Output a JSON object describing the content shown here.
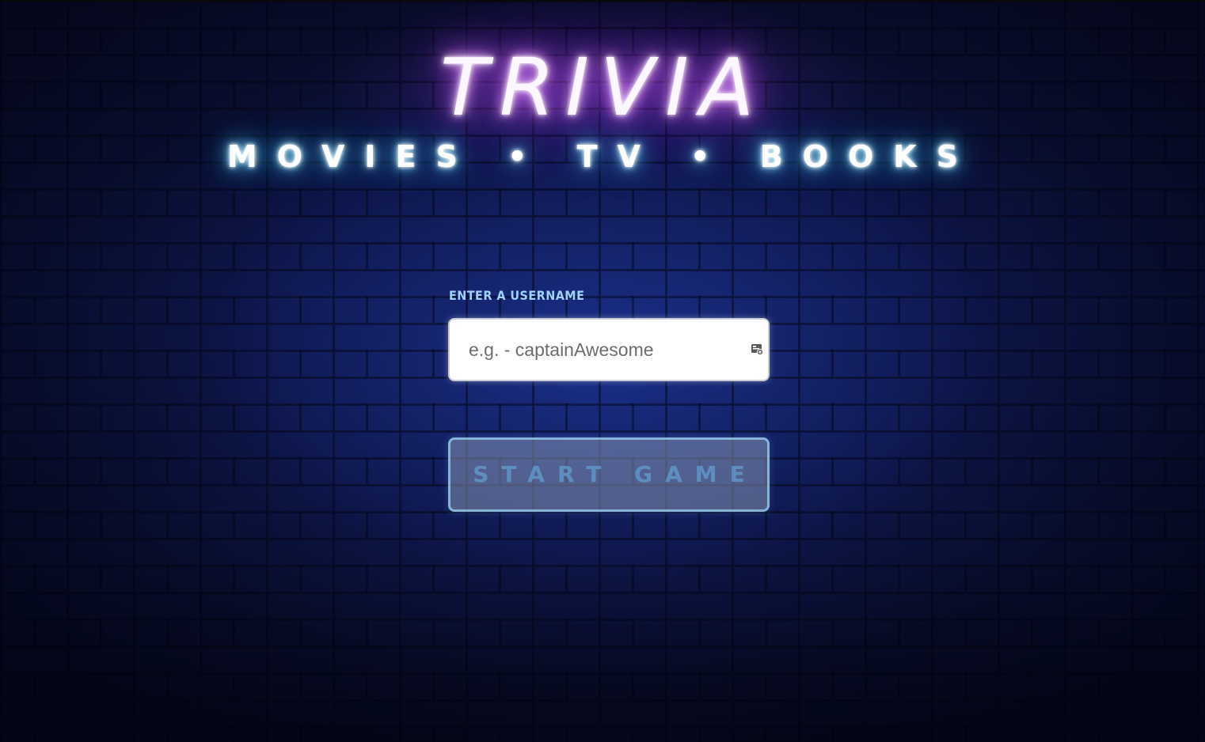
{
  "header": {
    "title": "TRIVIA",
    "subtitle": "MOVIES • TV • BOOKS"
  },
  "form": {
    "username_label": "ENTER A USERNAME",
    "username_value": "",
    "username_placeholder": "e.g. - captainAwesome",
    "autofill_icon": "contact-card-icon",
    "start_label": "START GAME"
  },
  "colors": {
    "title_glow": "#d66dff",
    "subtitle_glow": "#5ad3ff",
    "label": "#9ed1ff",
    "button_border": "#96c8eb"
  }
}
